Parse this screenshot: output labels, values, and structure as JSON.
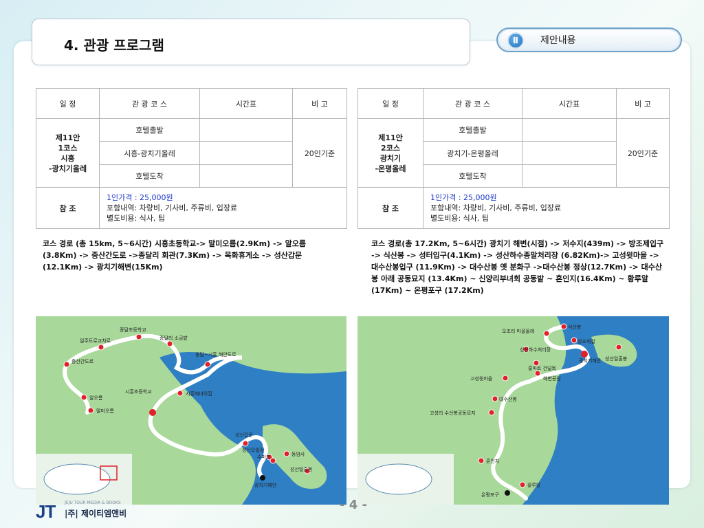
{
  "header": {
    "title": "4. 관광 프로그램",
    "badge_numeral": "Ⅱ",
    "badge_text": "제안내용"
  },
  "columns": [
    "일 정",
    "관 광 코 스",
    "시간표",
    "비 고"
  ],
  "tables": [
    {
      "schedule_lines": [
        "제11안",
        "1코스",
        "시흥",
        "-광치기올레"
      ],
      "rows": [
        "호텔출발",
        "시흥-광치기올레",
        "호텔도착"
      ],
      "note": "20인기준",
      "ref_label": "참 조",
      "ref_price": "1인가격 : 25,000원",
      "ref_includes": "포함내역: 차량비, 기사비, 주류비, 입장료",
      "ref_extra": "별도비용: 식사, 팁"
    },
    {
      "schedule_lines": [
        "제11안",
        "2코스",
        "광치기",
        "-온평올레"
      ],
      "rows": [
        "호텔출발",
        "광치기-온평올레",
        "호텔도착"
      ],
      "note": "20인기준",
      "ref_label": "참 조",
      "ref_price": "1인가격 : 25,000원",
      "ref_includes": "포함내역: 차량비, 기사비, 주류비, 입장료",
      "ref_extra": "별도비용: 식사, 팁"
    }
  ],
  "courses": [
    "코스 경로 (총 15km, 5~6시간) 시흥초등학교-> 말미오름(2.9Km) -> 알오름(3.8Km) -> 중산간도로 ->종달리 회관(7.3Km) -> 목화휴게소 -> 성산갑문(12.1Km) -> 광치기해변(15Km)",
    "코스 경로(총 17.2Km, 5~6시간) 광치기 해변(시점) -> 저수지(439m) -> 방조제입구 -> 식산봉 -> 성터입구(4.1Km) -> 성산하수종말처리장 (6.82Km)-> 고성윗마을 -> 대수산봉입구 (11.9Km) -> 대수산봉 옛 분화구 ->대수산봉 정상(12.7Km) -> 대수산봉 아래 공동묘지 (13.4Km) ~ 신양리부녀회 공동밭 ~ 혼인지(16.4Km) ~ 황루알(17Km) ~ 온평포구 (17.2Km)"
  ],
  "map1_labels": [
    "종달초등학교",
    "종달리 소금밭",
    "일주도로교차로",
    "종달~시흥 해안도로",
    "중산간도로",
    "시흥초등학교",
    "시흥해녀의집",
    "알오름",
    "말미오름",
    "성산갑문",
    "성산오일장",
    "동암사",
    "수마포",
    "광치기해안",
    "성산일출봉"
  ],
  "map2_labels": [
    "오조리 마을올레",
    "식산봉",
    "방조제길",
    "성산하수처리장",
    "광치기해안",
    "성산일출봉",
    "홍마트 건널목",
    "해변공원",
    "고성윗마을",
    "대수산봉",
    "고성리 수산봉공동묘지",
    "혼인지",
    "황루알",
    "온평포구"
  ],
  "footer": {
    "logo_mark": "JT",
    "logo_sub": "JEJU TOUR MEDIA & BOOKS",
    "logo_name": "|주| 제이티엠앤비",
    "page_number": "- 4 -"
  },
  "colors": {
    "price_blue": "#1a37c8",
    "badge_blue": "#1d6fb8",
    "route_white": "#ffffff",
    "marker_red": "#e0202a",
    "sea_blue": "#2f7fc4",
    "land_green": "#a8d89a"
  }
}
